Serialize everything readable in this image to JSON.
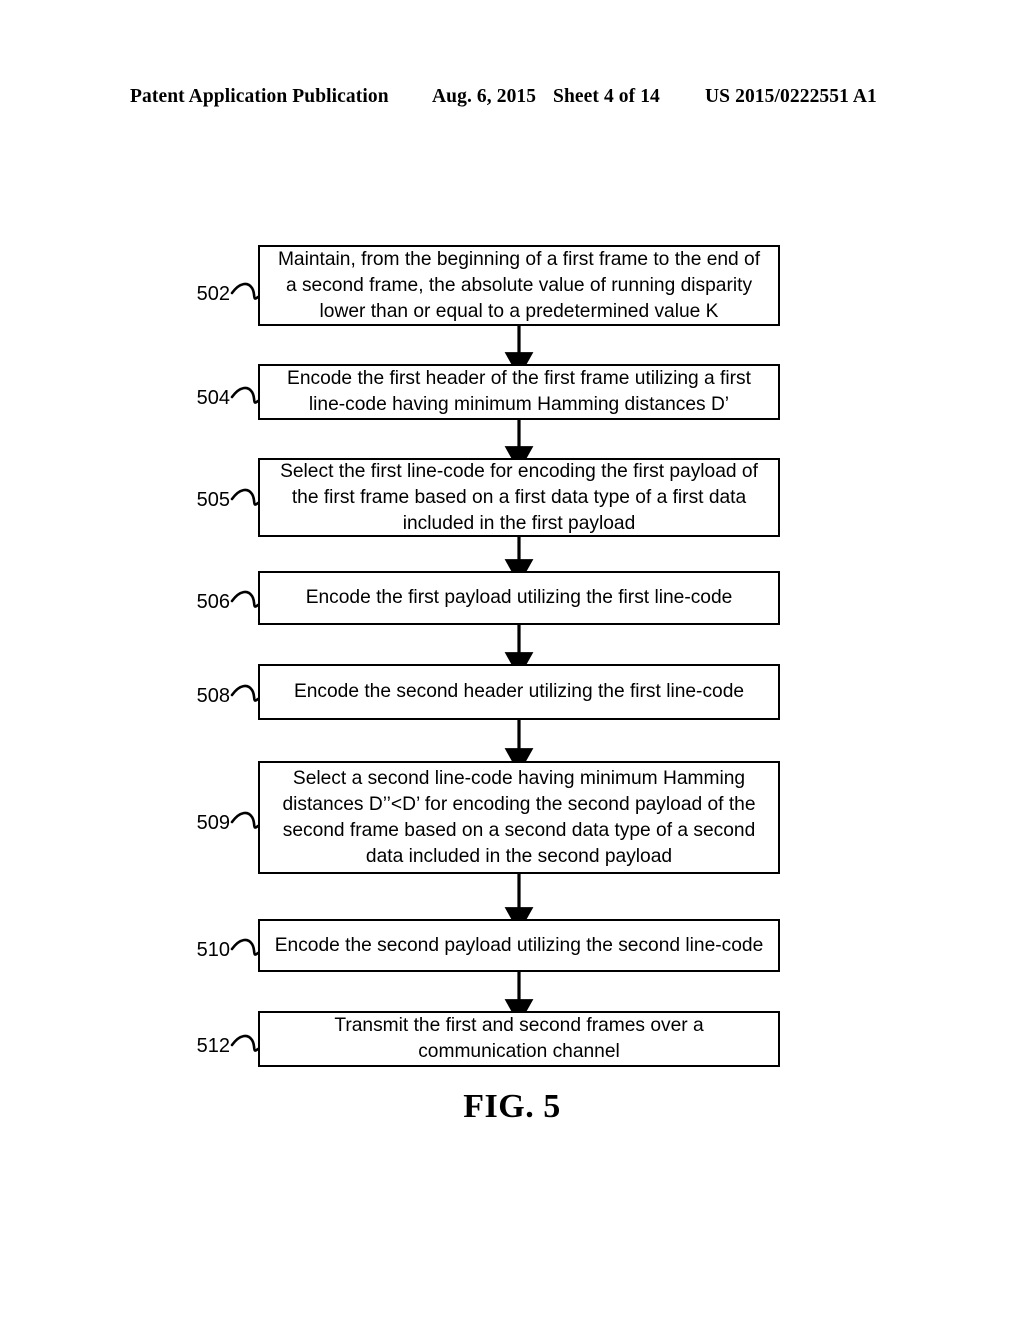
{
  "header": {
    "publication": "Patent Application Publication",
    "date": "Aug. 6, 2015",
    "sheet": "Sheet 4 of 14",
    "pub_number": "US 2015/0222551 A1"
  },
  "figure": {
    "caption": "FIG. 5",
    "type": "flowchart",
    "colors": {
      "ink": "#000000",
      "paper": "#ffffff"
    },
    "steps": [
      {
        "ref": "502",
        "text": "Maintain, from the beginning of a first frame to the end of a second frame, the absolute value of running disparity lower than or equal to a predetermined value K"
      },
      {
        "ref": "504",
        "text": "Encode the first header of the first frame utilizing a first line-code having minimum Hamming distances D’"
      },
      {
        "ref": "505",
        "text": "Select the first line-code for encoding the first payload of the first frame based on a first data type of a first data included in the first payload"
      },
      {
        "ref": "506",
        "text": "Encode the first payload utilizing the first line-code"
      },
      {
        "ref": "508",
        "text": "Encode the second header utilizing the first line-code"
      },
      {
        "ref": "509",
        "text": "Select a second line-code having minimum Hamming distances D’’<D’ for encoding the second payload of the second frame based on a second data type of a second data included in the second payload"
      },
      {
        "ref": "510",
        "text": "Encode the second payload utilizing the second line-code"
      },
      {
        "ref": "512",
        "text": "Transmit the first and second frames over a communication channel"
      }
    ]
  }
}
